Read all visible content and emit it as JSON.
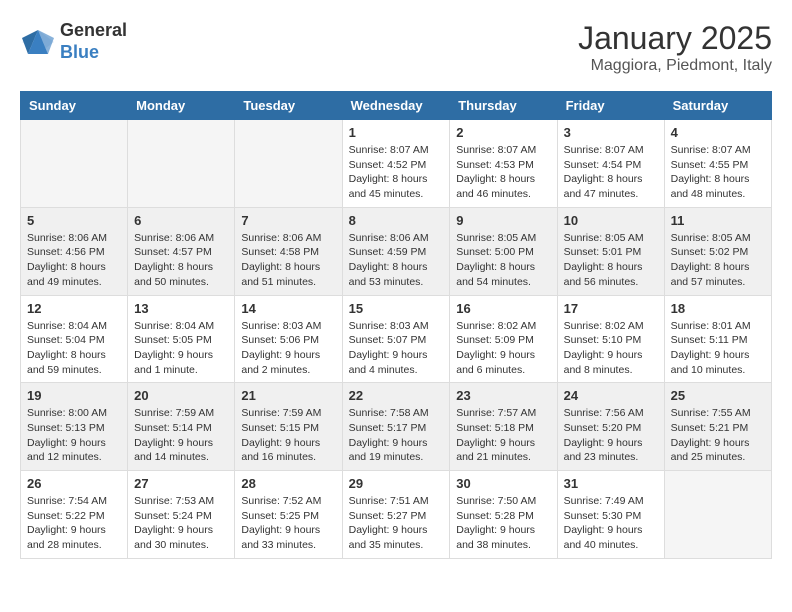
{
  "header": {
    "logo": {
      "general": "General",
      "blue": "Blue"
    },
    "title": "January 2025",
    "location": "Maggiora, Piedmont, Italy"
  },
  "weekdays": [
    "Sunday",
    "Monday",
    "Tuesday",
    "Wednesday",
    "Thursday",
    "Friday",
    "Saturday"
  ],
  "weeks": [
    [
      {
        "day": "",
        "info": ""
      },
      {
        "day": "",
        "info": ""
      },
      {
        "day": "",
        "info": ""
      },
      {
        "day": "1",
        "info": "Sunrise: 8:07 AM\nSunset: 4:52 PM\nDaylight: 8 hours\nand 45 minutes."
      },
      {
        "day": "2",
        "info": "Sunrise: 8:07 AM\nSunset: 4:53 PM\nDaylight: 8 hours\nand 46 minutes."
      },
      {
        "day": "3",
        "info": "Sunrise: 8:07 AM\nSunset: 4:54 PM\nDaylight: 8 hours\nand 47 minutes."
      },
      {
        "day": "4",
        "info": "Sunrise: 8:07 AM\nSunset: 4:55 PM\nDaylight: 8 hours\nand 48 minutes."
      }
    ],
    [
      {
        "day": "5",
        "info": "Sunrise: 8:06 AM\nSunset: 4:56 PM\nDaylight: 8 hours\nand 49 minutes."
      },
      {
        "day": "6",
        "info": "Sunrise: 8:06 AM\nSunset: 4:57 PM\nDaylight: 8 hours\nand 50 minutes."
      },
      {
        "day": "7",
        "info": "Sunrise: 8:06 AM\nSunset: 4:58 PM\nDaylight: 8 hours\nand 51 minutes."
      },
      {
        "day": "8",
        "info": "Sunrise: 8:06 AM\nSunset: 4:59 PM\nDaylight: 8 hours\nand 53 minutes."
      },
      {
        "day": "9",
        "info": "Sunrise: 8:05 AM\nSunset: 5:00 PM\nDaylight: 8 hours\nand 54 minutes."
      },
      {
        "day": "10",
        "info": "Sunrise: 8:05 AM\nSunset: 5:01 PM\nDaylight: 8 hours\nand 56 minutes."
      },
      {
        "day": "11",
        "info": "Sunrise: 8:05 AM\nSunset: 5:02 PM\nDaylight: 8 hours\nand 57 minutes."
      }
    ],
    [
      {
        "day": "12",
        "info": "Sunrise: 8:04 AM\nSunset: 5:04 PM\nDaylight: 8 hours\nand 59 minutes."
      },
      {
        "day": "13",
        "info": "Sunrise: 8:04 AM\nSunset: 5:05 PM\nDaylight: 9 hours\nand 1 minute."
      },
      {
        "day": "14",
        "info": "Sunrise: 8:03 AM\nSunset: 5:06 PM\nDaylight: 9 hours\nand 2 minutes."
      },
      {
        "day": "15",
        "info": "Sunrise: 8:03 AM\nSunset: 5:07 PM\nDaylight: 9 hours\nand 4 minutes."
      },
      {
        "day": "16",
        "info": "Sunrise: 8:02 AM\nSunset: 5:09 PM\nDaylight: 9 hours\nand 6 minutes."
      },
      {
        "day": "17",
        "info": "Sunrise: 8:02 AM\nSunset: 5:10 PM\nDaylight: 9 hours\nand 8 minutes."
      },
      {
        "day": "18",
        "info": "Sunrise: 8:01 AM\nSunset: 5:11 PM\nDaylight: 9 hours\nand 10 minutes."
      }
    ],
    [
      {
        "day": "19",
        "info": "Sunrise: 8:00 AM\nSunset: 5:13 PM\nDaylight: 9 hours\nand 12 minutes."
      },
      {
        "day": "20",
        "info": "Sunrise: 7:59 AM\nSunset: 5:14 PM\nDaylight: 9 hours\nand 14 minutes."
      },
      {
        "day": "21",
        "info": "Sunrise: 7:59 AM\nSunset: 5:15 PM\nDaylight: 9 hours\nand 16 minutes."
      },
      {
        "day": "22",
        "info": "Sunrise: 7:58 AM\nSunset: 5:17 PM\nDaylight: 9 hours\nand 19 minutes."
      },
      {
        "day": "23",
        "info": "Sunrise: 7:57 AM\nSunset: 5:18 PM\nDaylight: 9 hours\nand 21 minutes."
      },
      {
        "day": "24",
        "info": "Sunrise: 7:56 AM\nSunset: 5:20 PM\nDaylight: 9 hours\nand 23 minutes."
      },
      {
        "day": "25",
        "info": "Sunrise: 7:55 AM\nSunset: 5:21 PM\nDaylight: 9 hours\nand 25 minutes."
      }
    ],
    [
      {
        "day": "26",
        "info": "Sunrise: 7:54 AM\nSunset: 5:22 PM\nDaylight: 9 hours\nand 28 minutes."
      },
      {
        "day": "27",
        "info": "Sunrise: 7:53 AM\nSunset: 5:24 PM\nDaylight: 9 hours\nand 30 minutes."
      },
      {
        "day": "28",
        "info": "Sunrise: 7:52 AM\nSunset: 5:25 PM\nDaylight: 9 hours\nand 33 minutes."
      },
      {
        "day": "29",
        "info": "Sunrise: 7:51 AM\nSunset: 5:27 PM\nDaylight: 9 hours\nand 35 minutes."
      },
      {
        "day": "30",
        "info": "Sunrise: 7:50 AM\nSunset: 5:28 PM\nDaylight: 9 hours\nand 38 minutes."
      },
      {
        "day": "31",
        "info": "Sunrise: 7:49 AM\nSunset: 5:30 PM\nDaylight: 9 hours\nand 40 minutes."
      },
      {
        "day": "",
        "info": ""
      }
    ]
  ]
}
